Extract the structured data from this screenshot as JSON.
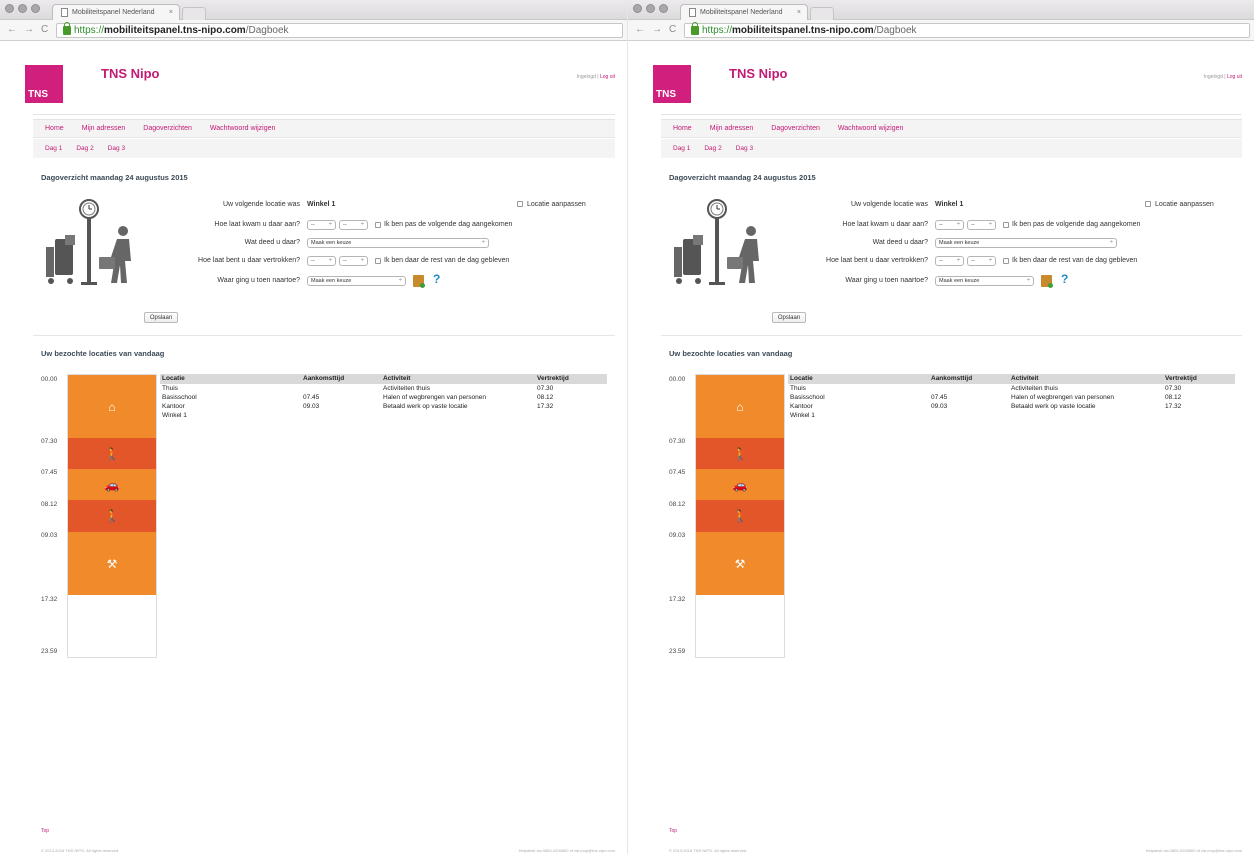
{
  "browser": {
    "tab_title": "Mobiliteitspanel Nederland",
    "url_scheme": "https://",
    "url_host": "mobiliteitspanel.tns-nipo.com",
    "url_path": "/Dagboek"
  },
  "header": {
    "logo_text": "TNS",
    "brand": "TNS Nipo",
    "logged_in": "Ingelogd |",
    "logout": "Log uit"
  },
  "nav": {
    "items": [
      "Home",
      "Mijn adressen",
      "Dagoverzichten",
      "Wachtwoord wijzigen"
    ]
  },
  "subnav": {
    "items": [
      "Dag 1",
      "Dag 2",
      "Dag 3"
    ]
  },
  "overview": {
    "title": "Dagoverzicht maandag 24 augustus 2015",
    "next_location_label": "Uw volgende locatie was",
    "next_location_value": "Winkel 1",
    "adjust_location": "Locatie aanpassen",
    "arrival_label": "Hoe laat kwam u daar aan?",
    "arrival_hour": "--",
    "arrival_min": "--",
    "next_day_check": "Ik ben pas de volgende dag aangekomen",
    "activity_label": "Wat deed u daar?",
    "activity_select": "Maak een keuze",
    "departure_label": "Hoe laat bent u daar vertrokken?",
    "departure_hour": "--",
    "departure_min": "--",
    "stayed_check": "Ik ben daar de rest van de dag gebleven",
    "next_dest_label": "Waar ging u toen naartoe?",
    "next_dest_select": "Maak een keuze",
    "help": "?",
    "save": "Opslaan"
  },
  "visited": {
    "title": "Uw bezochte locaties van vandaag",
    "columns": [
      "Locatie",
      "Aankomsttijd",
      "Activiteit",
      "Vertrektijd"
    ],
    "rows": [
      [
        "Thuis",
        "",
        "Activiteiten thuis",
        "07.30"
      ],
      [
        "Basisschool",
        "07.45",
        "Halen of wegbrengen van personen",
        "08.12"
      ],
      [
        "Kantoor",
        "09.03",
        "Betaald werk op vaste locatie",
        "17.32"
      ],
      [
        "Winkel 1",
        "",
        "",
        ""
      ]
    ],
    "timeline_labels": [
      "00.00",
      "07.30",
      "07.45",
      "08.12",
      "09.03",
      "17.32",
      "23.59"
    ],
    "segments": [
      {
        "icon": "home-icon",
        "glyph": "⌂",
        "color": "#f08a2a"
      },
      {
        "icon": "walk-icon",
        "glyph": "🚶",
        "color": "#e3562a"
      },
      {
        "icon": "car-icon",
        "glyph": "🚗",
        "color": "#f08a2a"
      },
      {
        "icon": "walk-icon",
        "glyph": "🚶",
        "color": "#e3562a"
      },
      {
        "icon": "work-icon",
        "glyph": "⚒",
        "color": "#f08a2a"
      }
    ]
  },
  "footer": {
    "top": "Top",
    "copyright": "© 2013-2016 TNS NIPO. All rights reserved.",
    "helpdesk": "Helpdesk via 0800-0200800 of via mop@tns-nipo.com"
  }
}
